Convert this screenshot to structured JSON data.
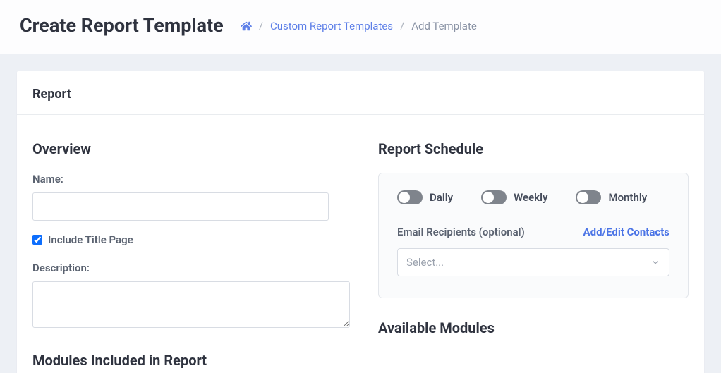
{
  "header": {
    "title": "Create Report Template",
    "breadcrumb": {
      "link1": "Custom Report Templates",
      "current": "Add Template"
    }
  },
  "card": {
    "title": "Report"
  },
  "overview": {
    "heading": "Overview",
    "name_label": "Name:",
    "name_value": "",
    "include_title_page_label": "Include Title Page",
    "include_title_page_checked": true,
    "description_label": "Description:",
    "description_value": "",
    "modules_included_heading": "Modules Included in Report"
  },
  "schedule": {
    "heading": "Report Schedule",
    "toggles": {
      "daily": "Daily",
      "weekly": "Weekly",
      "monthly": "Monthly"
    },
    "recipients_label": "Email Recipients (optional)",
    "add_edit_link": "Add/Edit Contacts",
    "select_placeholder": "Select...",
    "available_modules_heading": "Available Modules"
  }
}
